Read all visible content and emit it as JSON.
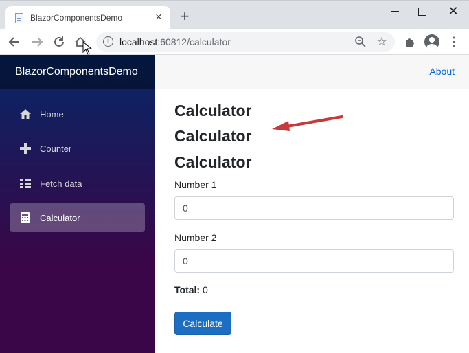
{
  "browser": {
    "tab_title": "BlazorComponentsDemo",
    "tab_close": "×",
    "new_tab": "+",
    "url_host": "localhost",
    "url_rest": ":60812/calculator"
  },
  "app": {
    "brand": "BlazorComponentsDemo",
    "about": "About",
    "nav": [
      {
        "label": "Home",
        "icon": "home-icon"
      },
      {
        "label": "Counter",
        "icon": "plus-icon"
      },
      {
        "label": "Fetch data",
        "icon": "list-icon"
      },
      {
        "label": "Calculator",
        "icon": "calculator-icon",
        "active": true
      }
    ]
  },
  "main": {
    "headings": [
      "Calculator",
      "Calculator",
      "Calculator"
    ],
    "number1_label": "Number 1",
    "number1_value": "0",
    "number2_label": "Number 2",
    "number2_value": "0",
    "total_label": "Total:",
    "total_value": "0",
    "calculate_label": "Calculate"
  },
  "colors": {
    "accent": "#1b6ec2",
    "link": "#0366d6",
    "annotation_arrow": "#c8393a"
  }
}
